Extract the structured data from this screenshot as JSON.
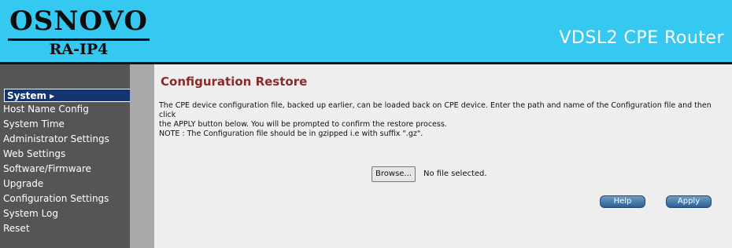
{
  "header": {
    "logo_title": "OSNOVO",
    "logo_subtitle": "RA-IP4",
    "product_name": "VDSL2 CPE Router",
    "brand_color": "#35c8f0"
  },
  "sidebar": {
    "items": [
      {
        "label": "System ▸",
        "active": true
      },
      {
        "label": "Host Name Config"
      },
      {
        "label": "System Time"
      },
      {
        "label": "Administrator Settings"
      },
      {
        "label": "Web Settings"
      },
      {
        "label": "Software/Firmware"
      },
      {
        "label": "Upgrade"
      },
      {
        "label": "Configuration Settings"
      },
      {
        "label": "System Log"
      },
      {
        "label": "Reset"
      }
    ]
  },
  "main": {
    "title": "Configuration Restore",
    "description_line1": "The CPE device configuration file, backed up earlier, can be loaded back on CPE device. Enter the path and name of the Configuration file and then click",
    "description_line2": "the APPLY button below. You will be prompted to confirm the restore process.",
    "note": "NOTE : The Configuration file should be in gzipped i.e with suffix \".gz\".",
    "file_input": {
      "browse_label": "Browse...",
      "status_text": "No file selected."
    },
    "buttons": {
      "help_label": "Help",
      "apply_label": "Apply"
    }
  }
}
